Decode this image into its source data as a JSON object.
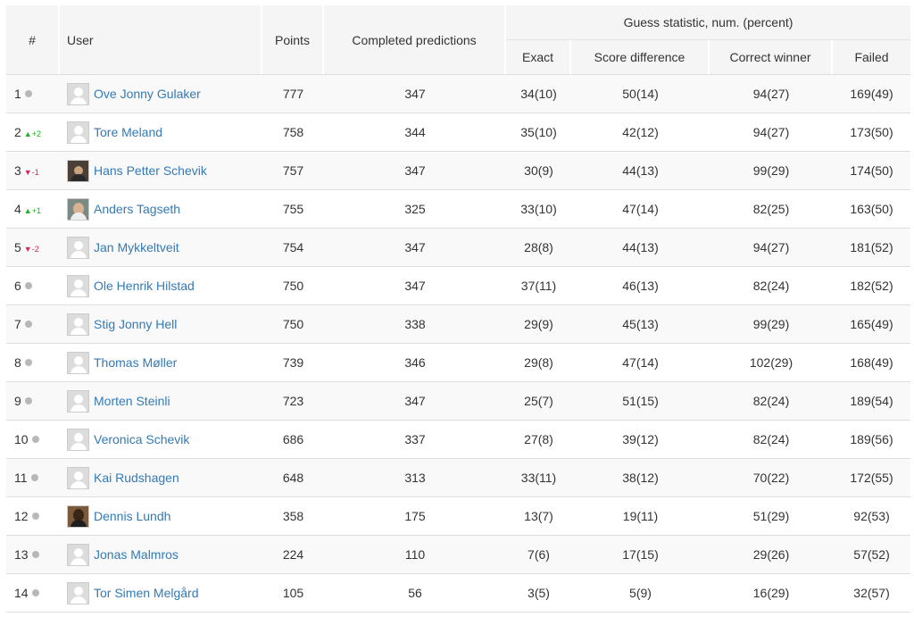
{
  "header": {
    "rank": "#",
    "user": "User",
    "points": "Points",
    "completed": "Completed predictions",
    "guess_stat": "Guess statistic, num. (percent)",
    "exact": "Exact",
    "score_diff": "Score difference",
    "correct_winner": "Correct winner",
    "failed": "Failed"
  },
  "rows": [
    {
      "rank": "1",
      "change": "",
      "dir": "none",
      "name": "Ove Jonny Gulaker",
      "avatar": "default-avatar-icon",
      "points": "777",
      "completed": "347",
      "exact": "34(10)",
      "score_diff": "50(14)",
      "correct_winner": "94(27)",
      "failed": "169(49)"
    },
    {
      "rank": "2",
      "change": "+2",
      "dir": "up",
      "name": "Tore Meland",
      "avatar": "default-avatar-icon",
      "points": "758",
      "completed": "344",
      "exact": "35(10)",
      "score_diff": "42(12)",
      "correct_winner": "94(27)",
      "failed": "173(50)"
    },
    {
      "rank": "3",
      "change": "-1",
      "dir": "down",
      "name": "Hans Petter Schevik",
      "avatar": "photo1",
      "points": "757",
      "completed": "347",
      "exact": "30(9)",
      "score_diff": "44(13)",
      "correct_winner": "99(29)",
      "failed": "174(50)"
    },
    {
      "rank": "4",
      "change": "+1",
      "dir": "up",
      "name": "Anders Tagseth",
      "avatar": "photo2",
      "points": "755",
      "completed": "325",
      "exact": "33(10)",
      "score_diff": "47(14)",
      "correct_winner": "82(25)",
      "failed": "163(50)"
    },
    {
      "rank": "5",
      "change": "-2",
      "dir": "down",
      "name": "Jan Mykkeltveit",
      "avatar": "default-avatar-icon",
      "points": "754",
      "completed": "347",
      "exact": "28(8)",
      "score_diff": "44(13)",
      "correct_winner": "94(27)",
      "failed": "181(52)"
    },
    {
      "rank": "6",
      "change": "",
      "dir": "none",
      "name": "Ole Henrik Hilstad",
      "avatar": "default-avatar-icon",
      "points": "750",
      "completed": "347",
      "exact": "37(11)",
      "score_diff": "46(13)",
      "correct_winner": "82(24)",
      "failed": "182(52)"
    },
    {
      "rank": "7",
      "change": "",
      "dir": "none",
      "name": "Stig Jonny Hell",
      "avatar": "default-avatar-icon",
      "points": "750",
      "completed": "338",
      "exact": "29(9)",
      "score_diff": "45(13)",
      "correct_winner": "99(29)",
      "failed": "165(49)"
    },
    {
      "rank": "8",
      "change": "",
      "dir": "none",
      "name": "Thomas Møller",
      "avatar": "default-avatar-icon",
      "points": "739",
      "completed": "346",
      "exact": "29(8)",
      "score_diff": "47(14)",
      "correct_winner": "102(29)",
      "failed": "168(49)"
    },
    {
      "rank": "9",
      "change": "",
      "dir": "none",
      "name": "Morten Steinli",
      "avatar": "default-avatar-icon",
      "points": "723",
      "completed": "347",
      "exact": "25(7)",
      "score_diff": "51(15)",
      "correct_winner": "82(24)",
      "failed": "189(54)"
    },
    {
      "rank": "10",
      "change": "",
      "dir": "none",
      "name": "Veronica Schevik",
      "avatar": "default-avatar-icon",
      "points": "686",
      "completed": "337",
      "exact": "27(8)",
      "score_diff": "39(12)",
      "correct_winner": "82(24)",
      "failed": "189(56)"
    },
    {
      "rank": "11",
      "change": "",
      "dir": "none",
      "name": "Kai Rudshagen",
      "avatar": "default-avatar-icon",
      "points": "648",
      "completed": "313",
      "exact": "33(11)",
      "score_diff": "38(12)",
      "correct_winner": "70(22)",
      "failed": "172(55)"
    },
    {
      "rank": "12",
      "change": "",
      "dir": "none",
      "name": "Dennis Lundh",
      "avatar": "photo3",
      "points": "358",
      "completed": "175",
      "exact": "13(7)",
      "score_diff": "19(11)",
      "correct_winner": "51(29)",
      "failed": "92(53)"
    },
    {
      "rank": "13",
      "change": "",
      "dir": "none",
      "name": "Jonas Malmros",
      "avatar": "default-avatar-icon",
      "points": "224",
      "completed": "110",
      "exact": "7(6)",
      "score_diff": "17(15)",
      "correct_winner": "29(26)",
      "failed": "57(52)"
    },
    {
      "rank": "14",
      "change": "",
      "dir": "none",
      "name": "Tor Simen Melgård",
      "avatar": "default-avatar-icon",
      "points": "105",
      "completed": "56",
      "exact": "3(5)",
      "score_diff": "5(9)",
      "correct_winner": "16(29)",
      "failed": "32(57)"
    }
  ],
  "colors": {
    "link": "#337ab7",
    "up": "#22b222",
    "down": "#d9265a",
    "neutral_dot": "#b8b8b8",
    "header_bg": "#f5f5f5",
    "stripe": "#f9f9f9"
  }
}
